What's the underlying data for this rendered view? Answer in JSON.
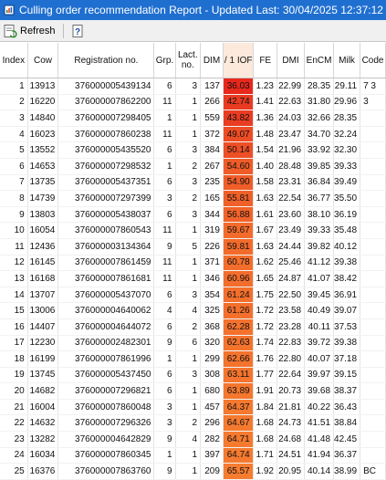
{
  "window": {
    "title": "Culling order recommendation Report - Updated Last: 30/04/2025 12:37:12",
    "icon": "report-icon"
  },
  "toolbar": {
    "refresh_label": "Refresh",
    "refresh_icon": "refresh-icon",
    "help_icon": "help-icon"
  },
  "table": {
    "columns": [
      "Index",
      "Cow",
      "Registration no.",
      "Grp.",
      "Lact. no.",
      "DIM",
      "/ 1 IOF",
      "FE",
      "DMI",
      "EnCM",
      "Milk",
      "Code"
    ],
    "rows": [
      {
        "index": "1",
        "cow": "13913",
        "reg": "376000005439134",
        "grp": "6",
        "lact": "3",
        "dim": "137",
        "iof": "36.03",
        "fe": "1.23",
        "dmi": "22.99",
        "encm": "28.35",
        "milk": "29.11",
        "code": "7  3",
        "color": "#e8281c"
      },
      {
        "index": "2",
        "cow": "16220",
        "reg": "376000007862200",
        "grp": "11",
        "lact": "1",
        "dim": "266",
        "iof": "42.74",
        "fe": "1.41",
        "dmi": "22.63",
        "encm": "31.80",
        "milk": "29.96",
        "code": "3",
        "color": "#ea3a21"
      },
      {
        "index": "3",
        "cow": "14840",
        "reg": "376000007298405",
        "grp": "1",
        "lact": "1",
        "dim": "559",
        "iof": "43.82",
        "fe": "1.36",
        "dmi": "24.03",
        "encm": "32.66",
        "milk": "28.35",
        "code": "",
        "color": "#ea3c22"
      },
      {
        "index": "4",
        "cow": "16023",
        "reg": "376000007860238",
        "grp": "11",
        "lact": "1",
        "dim": "372",
        "iof": "49.07",
        "fe": "1.48",
        "dmi": "23.47",
        "encm": "34.70",
        "milk": "32.24",
        "code": "",
        "color": "#ed4c25"
      },
      {
        "index": "5",
        "cow": "13552",
        "reg": "376000005435520",
        "grp": "6",
        "lact": "3",
        "dim": "384",
        "iof": "50.14",
        "fe": "1.54",
        "dmi": "21.96",
        "encm": "33.92",
        "milk": "32.30",
        "code": "",
        "color": "#ee4f26"
      },
      {
        "index": "6",
        "cow": "14653",
        "reg": "376000007298532",
        "grp": "1",
        "lact": "2",
        "dim": "267",
        "iof": "54.60",
        "fe": "1.40",
        "dmi": "28.48",
        "encm": "39.85",
        "milk": "39.33",
        "code": "",
        "color": "#f05c28"
      },
      {
        "index": "7",
        "cow": "13735",
        "reg": "376000005437351",
        "grp": "6",
        "lact": "3",
        "dim": "235",
        "iof": "54.90",
        "fe": "1.58",
        "dmi": "23.31",
        "encm": "36.84",
        "milk": "39.49",
        "code": "",
        "color": "#f05d28"
      },
      {
        "index": "8",
        "cow": "14739",
        "reg": "376000007297399",
        "grp": "3",
        "lact": "2",
        "dim": "165",
        "iof": "55.81",
        "fe": "1.63",
        "dmi": "22.54",
        "encm": "36.77",
        "milk": "35.50",
        "code": "",
        "color": "#f06029"
      },
      {
        "index": "9",
        "cow": "13803",
        "reg": "376000005438037",
        "grp": "6",
        "lact": "3",
        "dim": "344",
        "iof": "56.88",
        "fe": "1.61",
        "dmi": "23.60",
        "encm": "38.10",
        "milk": "36.19",
        "code": "",
        "color": "#f1632a"
      },
      {
        "index": "10",
        "cow": "16054",
        "reg": "376000007860543",
        "grp": "11",
        "lact": "1",
        "dim": "319",
        "iof": "59.67",
        "fe": "1.67",
        "dmi": "23.49",
        "encm": "39.33",
        "milk": "35.48",
        "code": "",
        "color": "#f36b2b"
      },
      {
        "index": "11",
        "cow": "12436",
        "reg": "376000003134364",
        "grp": "9",
        "lact": "5",
        "dim": "226",
        "iof": "59.81",
        "fe": "1.63",
        "dmi": "24.44",
        "encm": "39.82",
        "milk": "40.12",
        "code": "",
        "color": "#f36b2b"
      },
      {
        "index": "12",
        "cow": "16145",
        "reg": "376000007861459",
        "grp": "11",
        "lact": "1",
        "dim": "371",
        "iof": "60.78",
        "fe": "1.62",
        "dmi": "25.46",
        "encm": "41.12",
        "milk": "39.38",
        "code": "",
        "color": "#f36e2c"
      },
      {
        "index": "13",
        "cow": "16168",
        "reg": "376000007861681",
        "grp": "11",
        "lact": "1",
        "dim": "346",
        "iof": "60.96",
        "fe": "1.65",
        "dmi": "24.87",
        "encm": "41.07",
        "milk": "38.42",
        "code": "",
        "color": "#f36e2c"
      },
      {
        "index": "14",
        "cow": "13707",
        "reg": "376000005437070",
        "grp": "6",
        "lact": "3",
        "dim": "354",
        "iof": "61.24",
        "fe": "1.75",
        "dmi": "22.50",
        "encm": "39.45",
        "milk": "36.91",
        "code": "",
        "color": "#f46f2c"
      },
      {
        "index": "15",
        "cow": "13006",
        "reg": "376000004640062",
        "grp": "4",
        "lact": "4",
        "dim": "325",
        "iof": "61.26",
        "fe": "1.72",
        "dmi": "23.58",
        "encm": "40.49",
        "milk": "39.07",
        "code": "",
        "color": "#f46f2c"
      },
      {
        "index": "16",
        "cow": "14407",
        "reg": "376000004644072",
        "grp": "6",
        "lact": "2",
        "dim": "368",
        "iof": "62.28",
        "fe": "1.72",
        "dmi": "23.28",
        "encm": "40.11",
        "milk": "37.53",
        "code": "",
        "color": "#f4722d"
      },
      {
        "index": "17",
        "cow": "12230",
        "reg": "376000002482301",
        "grp": "9",
        "lact": "6",
        "dim": "320",
        "iof": "62.63",
        "fe": "1.74",
        "dmi": "22.83",
        "encm": "39.72",
        "milk": "39.38",
        "code": "",
        "color": "#f4732d"
      },
      {
        "index": "18",
        "cow": "16199",
        "reg": "376000007861996",
        "grp": "1",
        "lact": "1",
        "dim": "299",
        "iof": "62.66",
        "fe": "1.76",
        "dmi": "22.80",
        "encm": "40.07",
        "milk": "37.18",
        "code": "",
        "color": "#f4732d"
      },
      {
        "index": "19",
        "cow": "13745",
        "reg": "376000005437450",
        "grp": "6",
        "lact": "3",
        "dim": "308",
        "iof": "63.11",
        "fe": "1.77",
        "dmi": "22.64",
        "encm": "39.97",
        "milk": "39.15",
        "code": "",
        "color": "#f5752e"
      },
      {
        "index": "20",
        "cow": "14682",
        "reg": "376000007296821",
        "grp": "6",
        "lact": "1",
        "dim": "680",
        "iof": "63.89",
        "fe": "1.91",
        "dmi": "20.73",
        "encm": "39.68",
        "milk": "38.37",
        "code": "",
        "color": "#f5772e"
      },
      {
        "index": "21",
        "cow": "16004",
        "reg": "376000007860048",
        "grp": "3",
        "lact": "1",
        "dim": "457",
        "iof": "64.37",
        "fe": "1.84",
        "dmi": "21.81",
        "encm": "40.22",
        "milk": "36.43",
        "code": "",
        "color": "#f5792f"
      },
      {
        "index": "22",
        "cow": "14632",
        "reg": "376000007296326",
        "grp": "3",
        "lact": "2",
        "dim": "296",
        "iof": "64.67",
        "fe": "1.68",
        "dmi": "24.73",
        "encm": "41.51",
        "milk": "38.84",
        "code": "",
        "color": "#f57a2f"
      },
      {
        "index": "23",
        "cow": "13282",
        "reg": "376000004642829",
        "grp": "9",
        "lact": "4",
        "dim": "282",
        "iof": "64.71",
        "fe": "1.68",
        "dmi": "24.68",
        "encm": "41.48",
        "milk": "42.45",
        "code": "",
        "color": "#f57a2f"
      },
      {
        "index": "24",
        "cow": "16034",
        "reg": "376000007860345",
        "grp": "1",
        "lact": "1",
        "dim": "397",
        "iof": "64.74",
        "fe": "1.71",
        "dmi": "24.51",
        "encm": "41.94",
        "milk": "36.37",
        "code": "",
        "color": "#f57a2f"
      },
      {
        "index": "25",
        "cow": "16376",
        "reg": "376000007863760",
        "grp": "9",
        "lact": "1",
        "dim": "209",
        "iof": "65.57",
        "fe": "1.92",
        "dmi": "20.95",
        "encm": "40.14",
        "milk": "38.99",
        "code": "BC",
        "color": "#f67c30"
      }
    ]
  }
}
